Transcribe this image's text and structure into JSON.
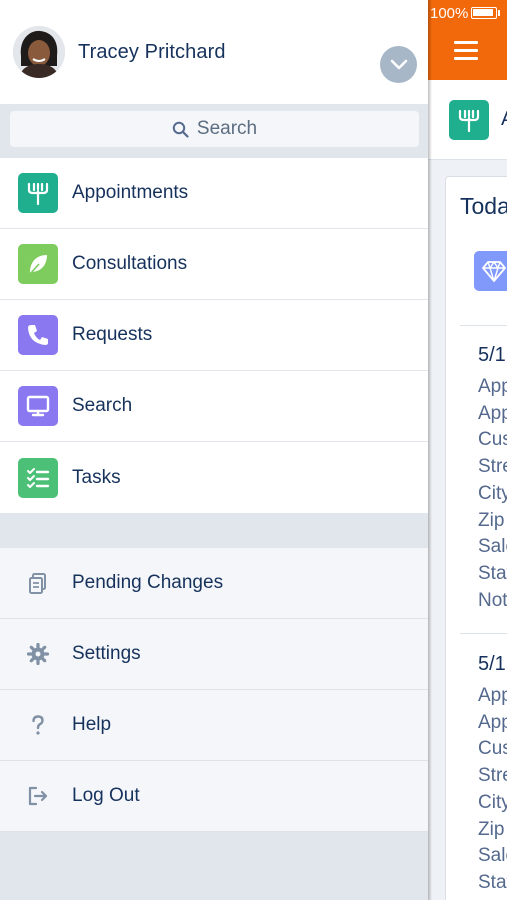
{
  "status": {
    "battery": "100%"
  },
  "profile": {
    "name": "Tracey Pritchard"
  },
  "search": {
    "placeholder": "Search"
  },
  "nav": [
    {
      "label": "Appointments",
      "icon": "appointments-icon",
      "color": "#1fae8e"
    },
    {
      "label": "Consultations",
      "icon": "leaf-icon",
      "color": "#7ecb5e"
    },
    {
      "label": "Requests",
      "icon": "phone-icon",
      "color": "#8a78f0"
    },
    {
      "label": "Search",
      "icon": "monitor-icon",
      "color": "#8a78f0"
    },
    {
      "label": "Tasks",
      "icon": "checklist-icon",
      "color": "#4bc076"
    }
  ],
  "utilities": [
    {
      "label": "Pending Changes",
      "icon": "pending-changes-icon"
    },
    {
      "label": "Settings",
      "icon": "gear-icon"
    },
    {
      "label": "Help",
      "icon": "help-icon"
    },
    {
      "label": "Log Out",
      "icon": "logout-icon"
    }
  ],
  "peek": {
    "header_text": "A",
    "card_title": "Toda",
    "records": [
      {
        "date": "5/1",
        "fields": [
          "App",
          "App",
          "Cus",
          "Stre",
          "City",
          "Zip",
          "Sale",
          "Stat",
          "Not"
        ]
      },
      {
        "date": "5/1",
        "fields": [
          "App",
          "App",
          "Cus",
          "Stre",
          "City",
          "Zip",
          "Sale",
          "Stat"
        ]
      }
    ]
  }
}
